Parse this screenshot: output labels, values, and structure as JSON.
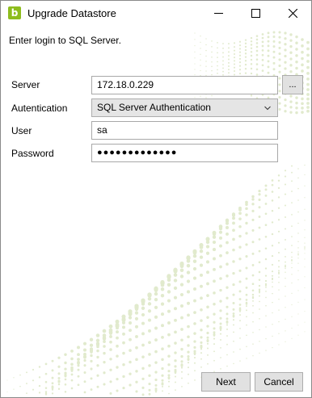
{
  "window": {
    "title": "Upgrade Datastore",
    "app_icon_glyph": "b",
    "accent": "#8ebd1e"
  },
  "intro": "Enter login to SQL Server.",
  "form": {
    "server_label": "Server",
    "server_value": "172.18.0.229",
    "browse_label": "...",
    "auth_label": "Autentication",
    "auth_value": "SQL Server Authentication",
    "user_label": "User",
    "user_value": "sa",
    "password_label": "Password",
    "password_value": "●●●●●●●●●●●●●"
  },
  "buttons": {
    "next": "Next",
    "cancel": "Cancel"
  },
  "icons": {
    "minimize": "minimize-icon",
    "maximize": "maximize-icon",
    "close": "close-icon",
    "dropdown": "chevron-down-icon"
  }
}
